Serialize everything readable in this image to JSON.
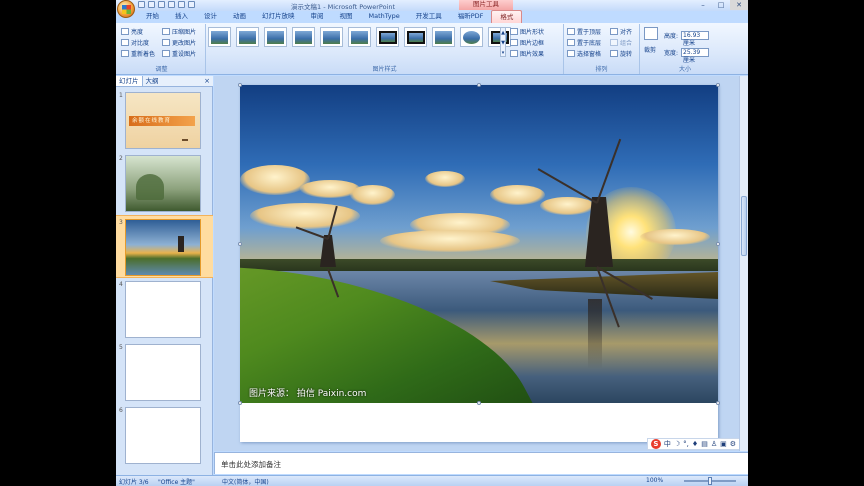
{
  "window": {
    "title": "演示文稿1 - Microsoft PowerPoint",
    "context_tab_title": "图片工具"
  },
  "ribbon_tabs": [
    "开始",
    "插入",
    "设计",
    "动画",
    "幻灯片放映",
    "审阅",
    "视图",
    "MathType",
    "开发工具",
    "福昕PDF",
    "格式"
  ],
  "active_tab": "格式",
  "ribbon": {
    "adjust": {
      "label": "调整",
      "items": [
        "亮度",
        "压缩图片",
        "对比度",
        "更改图片",
        "重新着色",
        "重设图片"
      ]
    },
    "picture_styles": {
      "label": "图片样式",
      "items": [
        "图片形状",
        "图片边框",
        "图片效果"
      ],
      "style_count": 11
    },
    "arrange": {
      "label": "排列",
      "items": [
        "置于顶层",
        "对齐",
        "置于底层",
        "组合",
        "选择窗格",
        "旋转"
      ]
    },
    "size": {
      "label": "大小",
      "crop_label": "裁剪",
      "height_label": "高度:",
      "height_value": "16.93 厘米",
      "width_label": "宽度:",
      "width_value": "25.39 厘米"
    }
  },
  "panel": {
    "tabs": [
      "幻灯片",
      "大纲"
    ],
    "close_icon": "×",
    "slides": [
      {
        "number": "1",
        "title_text": "余额在线教育"
      },
      {
        "number": "2",
        "title_text": ""
      },
      {
        "number": "3",
        "title_text": "",
        "selected": true
      },
      {
        "number": "4",
        "title_text": ""
      },
      {
        "number": "5",
        "title_text": ""
      },
      {
        "number": "6",
        "title_text": ""
      }
    ]
  },
  "slide": {
    "photo_credit": "图片来源：  拍信 Paixin.com"
  },
  "ime": {
    "logo": "S",
    "icons": [
      "中",
      "☽",
      "°,",
      "♦",
      "▤",
      "♙",
      "▣",
      "⚙"
    ]
  },
  "notes": {
    "placeholder": "单击此处添加备注"
  },
  "status": {
    "slide_indicator": "幻灯片 3/6",
    "theme": "\"Office 主题\"",
    "language": "中文(简体，中国)",
    "zoom": "100%"
  }
}
